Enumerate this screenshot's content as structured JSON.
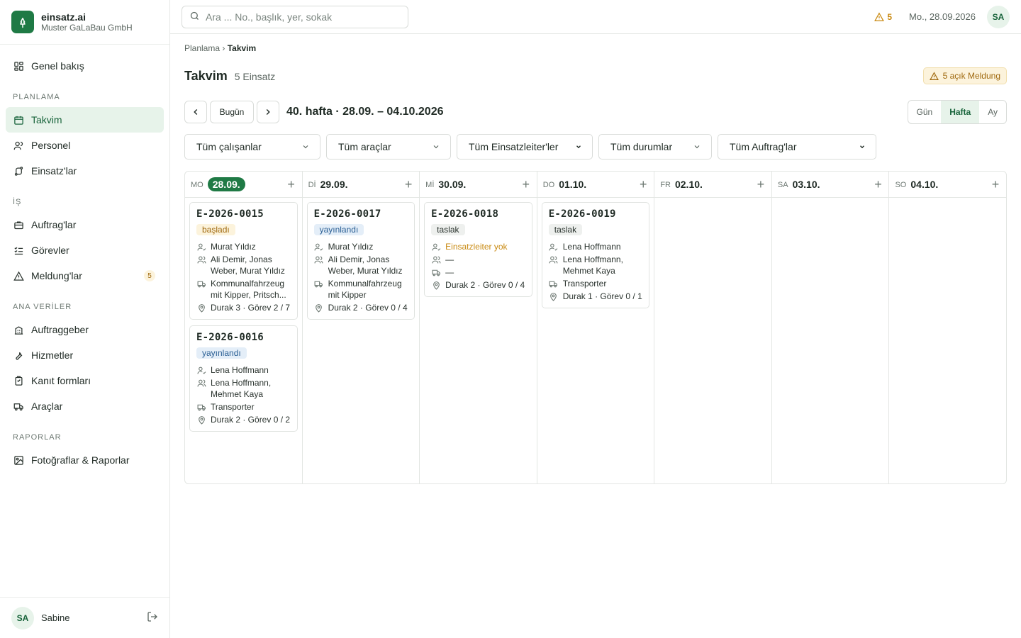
{
  "brand": {
    "name": "einsatz.ai",
    "company": "Muster GaLaBau GmbH"
  },
  "nav": {
    "overview": "Genel bakış",
    "sections": {
      "planning": "PLANLAMA",
      "work": "İŞ",
      "master": "ANA VERİLER",
      "reports": "RAPORLAR"
    },
    "calendar": "Takvim",
    "personnel": "Personel",
    "einsatze": "Einsatz'lar",
    "auftrage": "Auftrag'lar",
    "tasks": "Görevler",
    "meldungen": "Meldung'lar",
    "meldungen_badge": "5",
    "clients": "Auftraggeber",
    "services": "Hizmetler",
    "proof_forms": "Kanıt formları",
    "vehicles": "Araçlar",
    "photos": "Fotoğraflar & Raporlar"
  },
  "user": {
    "initials": "SA",
    "name": "Sabine"
  },
  "topbar": {
    "search_placeholder": "Ara ... No., başlık, yer, sokak",
    "alert_count": "5",
    "date": "Mo., 28.09.2026",
    "avatar": "SA"
  },
  "breadcrumb": {
    "parent": "Planlama",
    "sep": "›",
    "current": "Takvim"
  },
  "page": {
    "title": "Takvim",
    "count": "5 Einsatz",
    "meldung_badge": "5 açık Meldung"
  },
  "week": {
    "today_label": "Bugün",
    "label": "40. hafta · 28.09. – 04.10.2026"
  },
  "views": {
    "day": "Gün",
    "week": "Hafta",
    "month": "Ay",
    "active": "Hafta"
  },
  "filters": {
    "employees": "Tüm çalışanlar",
    "vehicles": "Tüm araçlar",
    "leaders": "Tüm Einsatzleiter'ler",
    "statuses": "Tüm durumlar",
    "orders": "Tüm Auftrag'lar"
  },
  "days": [
    {
      "dow": "MO",
      "date": "28.09.",
      "today": true
    },
    {
      "dow": "Dİ",
      "date": "29.09."
    },
    {
      "dow": "Mİ",
      "date": "30.09."
    },
    {
      "dow": "DO",
      "date": "01.10."
    },
    {
      "dow": "FR",
      "date": "02.10."
    },
    {
      "dow": "SA",
      "date": "03.10."
    },
    {
      "dow": "SO",
      "date": "04.10."
    }
  ],
  "cards": {
    "c15": {
      "id": "E-2026-0015",
      "status": "başladı",
      "leader": "Murat Yıldız",
      "team": "Ali Demir, Jonas Weber, Murat Yıldız",
      "vehicle": "Kommunalfahrzeug mit Kipper, Pritsch...",
      "stops": "Durak 3 · Görev 2 / 7"
    },
    "c16": {
      "id": "E-2026-0016",
      "status": "yayınlandı",
      "leader": "Lena Hoffmann",
      "team": "Lena Hoffmann, Mehmet Kaya",
      "vehicle": "Transporter",
      "stops": "Durak 2 · Görev 0 / 2"
    },
    "c17": {
      "id": "E-2026-0017",
      "status": "yayınlandı",
      "leader": "Murat Yıldız",
      "team": "Ali Demir, Jonas Weber, Murat Yıldız",
      "vehicle": "Kommunalfahrzeug mit Kipper",
      "stops": "Durak 2 · Görev 0 / 4"
    },
    "c18": {
      "id": "E-2026-0018",
      "status": "taslak",
      "leader": "Einsatzleiter yok",
      "team": "—",
      "vehicle": "—",
      "stops": "Durak 2 · Görev 0 / 4"
    },
    "c19": {
      "id": "E-2026-0019",
      "status": "taslak",
      "leader": "Lena Hoffmann",
      "team": "Lena Hoffmann, Mehmet Kaya",
      "vehicle": "Transporter",
      "stops": "Durak 1 · Görev 0 / 1"
    }
  },
  "colors": {
    "brand": "#1f7a45",
    "active_bg": "#e7f3ea",
    "warning": "#c98a12",
    "info": "#2a5f94"
  }
}
